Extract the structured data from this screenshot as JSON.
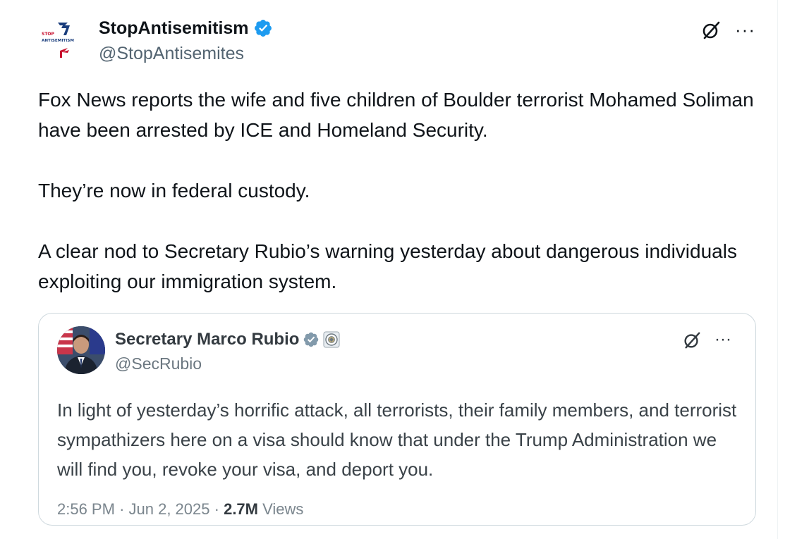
{
  "author": {
    "name": "StopAntisemitism",
    "handle": "@StopAntisemites",
    "logo_text_top": "STOP",
    "logo_text_bottom": "ANTISEMITISM",
    "verified_color": "#1d9bf0"
  },
  "tweet": {
    "paragraphs": [
      "Fox News reports the wife and five children of Boulder terrorist Mohamed Soliman have been arrested by ICE and Homeland Security.",
      "They’re now in federal custody.",
      "A clear nod to Secretary Rubio’s warning yesterday about dangerous individuals exploiting our immigration system."
    ]
  },
  "quoted_tweet": {
    "name": "Secretary Marco Rubio",
    "handle": "@SecRubio",
    "verified_color": "#829aab",
    "text": "In light of yesterday’s horrific attack, all terrorists, their family members, and terrorist sympathizers here on a visa should know that under the Trump Administration we will find you, revoke your visa, and deport you.",
    "time": "2:56 PM",
    "separator": "·",
    "date": "Jun 2, 2025",
    "views_count": "2.7M",
    "views_label": "Views"
  },
  "icons": {
    "grok": "grok-icon",
    "more": "more-icon"
  },
  "more_glyph": "···"
}
